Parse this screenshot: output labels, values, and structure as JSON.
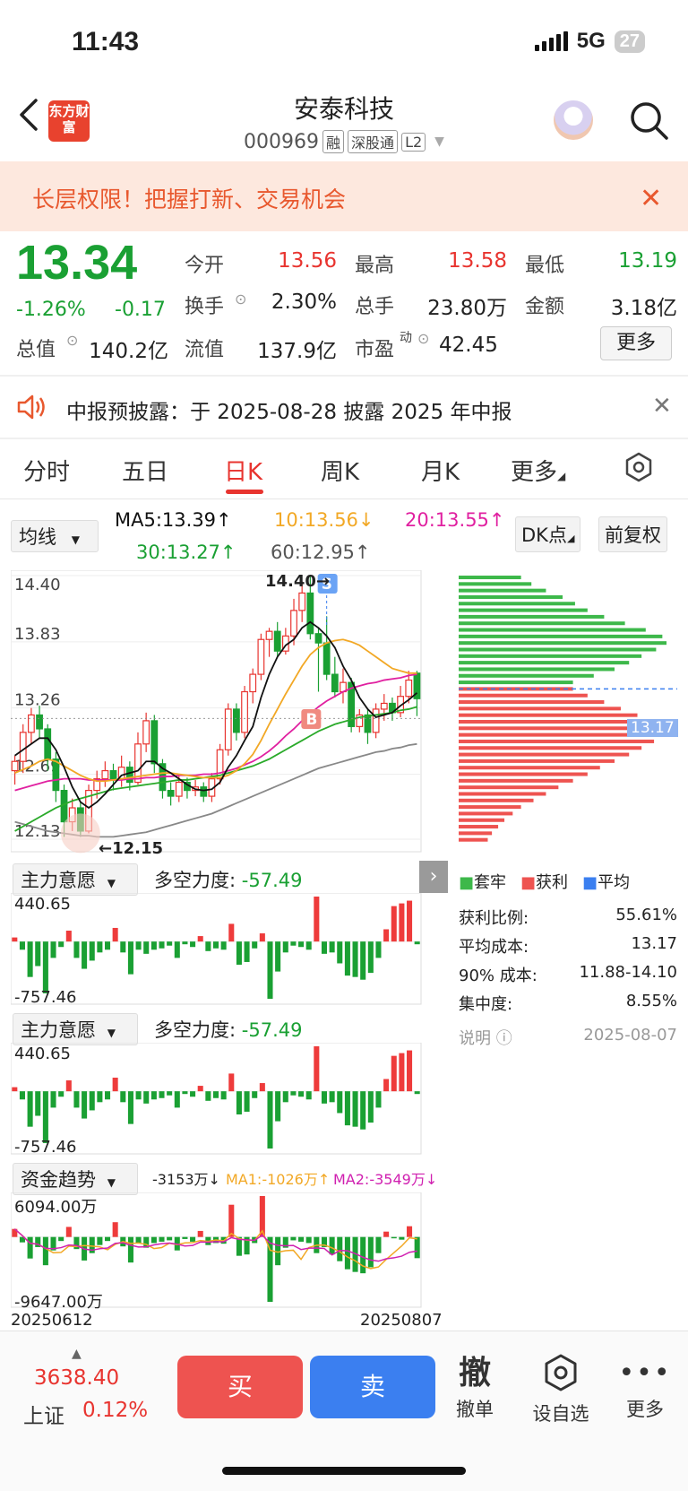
{
  "status": {
    "time": "11:43",
    "network": "5G",
    "battery": "27"
  },
  "header": {
    "title": "安泰科技",
    "code": "000969",
    "tags": [
      "融",
      "深股通",
      "L2"
    ],
    "logo_text": "东方财富"
  },
  "banner": {
    "text": "长层权限！把握打新、交易机会"
  },
  "quote": {
    "price": "13.34",
    "change_pct": "-1.26%",
    "change_abs": "-0.17",
    "open_label": "今开",
    "open": "13.56",
    "high_label": "最高",
    "high": "13.58",
    "low_label": "最低",
    "low": "13.19",
    "turnover_label": "换手",
    "turnover": "2.30%",
    "volume_label": "总手",
    "volume": "23.80万",
    "amount_label": "金额",
    "amount": "3.18亿",
    "mktcap_label": "总值",
    "mktcap": "140.2亿",
    "float_label": "流值",
    "float": "137.9亿",
    "pe_label": "市盈",
    "pe_sup": "动",
    "pe": "42.45",
    "more_label": "更多"
  },
  "notice": {
    "text": "中报预披露：于 2025-08-28 披露 2025 年中报"
  },
  "tabs": [
    "分时",
    "五日",
    "日K",
    "周K",
    "月K",
    "更多"
  ],
  "active_tab": "日K",
  "ma": {
    "selector": "均线",
    "ma5": "MA5:13.39↑",
    "ma10": "10:13.56↓",
    "ma20": "20:13.55↑",
    "ma30": "30:13.27↑",
    "ma60": "60:12.95↑",
    "dk_btn": "DK点",
    "fq_btn": "前复权"
  },
  "colors": {
    "up": "#e8342f",
    "down": "#1aa033",
    "ma5": "#111111",
    "ma10": "#f2a825",
    "ma20": "#e020a0",
    "ma30": "#2aaa2a",
    "ma60": "#888888",
    "avg": "#3b7ff0"
  },
  "kline": {
    "y_labels": [
      "14.40",
      "13.83",
      "13.26",
      "12.69",
      "12.13"
    ],
    "ylim": [
      12.13,
      14.4
    ],
    "high_mark": "14.40→",
    "low_mark": "←12.15",
    "b_marker": "B",
    "s_marker": "S",
    "avg_cost_tag": "13.17",
    "candles": [
      [
        12.72,
        12.8,
        12.6,
        12.85
      ],
      [
        12.8,
        13.05,
        12.7,
        13.12
      ],
      [
        13.05,
        13.2,
        12.95,
        13.26
      ],
      [
        13.2,
        13.08,
        13.0,
        13.28
      ],
      [
        13.08,
        12.82,
        12.72,
        13.12
      ],
      [
        12.82,
        12.55,
        12.45,
        12.88
      ],
      [
        12.55,
        12.28,
        12.15,
        12.6
      ],
      [
        12.28,
        12.4,
        12.2,
        12.48
      ],
      [
        12.4,
        12.2,
        12.15,
        12.45
      ],
      [
        12.2,
        12.55,
        12.18,
        12.6
      ],
      [
        12.55,
        12.65,
        12.48,
        12.72
      ],
      [
        12.65,
        12.72,
        12.58,
        12.8
      ],
      [
        12.72,
        12.65,
        12.55,
        12.78
      ],
      [
        12.65,
        12.75,
        12.58,
        12.85
      ],
      [
        12.75,
        12.62,
        12.55,
        12.8
      ],
      [
        12.62,
        12.95,
        12.6,
        13.05
      ],
      [
        12.95,
        13.15,
        12.88,
        13.22
      ],
      [
        13.15,
        12.78,
        12.7,
        13.2
      ],
      [
        12.78,
        12.55,
        12.48,
        12.82
      ],
      [
        12.55,
        12.5,
        12.42,
        12.62
      ],
      [
        12.5,
        12.62,
        12.45,
        12.68
      ],
      [
        12.62,
        12.55,
        12.48,
        12.66
      ],
      [
        12.55,
        12.58,
        12.5,
        12.64
      ],
      [
        12.58,
        12.5,
        12.45,
        12.62
      ],
      [
        12.5,
        12.65,
        12.45,
        12.7
      ],
      [
        12.65,
        12.9,
        12.6,
        12.95
      ],
      [
        12.9,
        13.25,
        12.85,
        13.3
      ],
      [
        13.25,
        13.05,
        12.98,
        13.3
      ],
      [
        13.05,
        13.4,
        13.0,
        13.45
      ],
      [
        13.4,
        13.55,
        13.3,
        13.6
      ],
      [
        13.55,
        13.85,
        13.5,
        13.9
      ],
      [
        13.85,
        13.92,
        13.7,
        13.95
      ],
      [
        13.92,
        13.75,
        13.7,
        14.0
      ],
      [
        13.75,
        13.88,
        13.72,
        13.95
      ],
      [
        13.88,
        14.1,
        13.8,
        14.2
      ],
      [
        14.1,
        14.25,
        14.0,
        14.35
      ],
      [
        14.25,
        13.9,
        13.85,
        14.4
      ],
      [
        13.9,
        13.82,
        13.4,
        13.95
      ],
      [
        13.82,
        13.55,
        13.5,
        14.05
      ],
      [
        13.55,
        13.4,
        13.35,
        13.7
      ],
      [
        13.4,
        13.48,
        13.3,
        13.6
      ],
      [
        13.48,
        13.1,
        13.05,
        13.52
      ],
      [
        13.1,
        13.2,
        13.05,
        13.25
      ],
      [
        13.2,
        13.05,
        12.95,
        13.25
      ],
      [
        13.05,
        13.25,
        13.0,
        13.3
      ],
      [
        13.25,
        13.3,
        13.15,
        13.38
      ],
      [
        13.3,
        13.22,
        13.15,
        13.35
      ],
      [
        13.22,
        13.36,
        13.18,
        13.45
      ],
      [
        13.36,
        13.5,
        13.3,
        13.58
      ],
      [
        13.56,
        13.34,
        13.19,
        13.58
      ]
    ],
    "ma5_line": [
      12.85,
      12.9,
      12.95,
      13.0,
      13.0,
      12.9,
      12.75,
      12.58,
      12.45,
      12.4,
      12.45,
      12.52,
      12.6,
      12.68,
      12.7,
      12.72,
      12.8,
      12.8,
      12.74,
      12.7,
      12.65,
      12.6,
      12.56,
      12.55,
      12.56,
      12.62,
      12.75,
      12.85,
      12.98,
      13.1,
      13.35,
      13.55,
      13.7,
      13.8,
      13.85,
      13.95,
      14.0,
      13.95,
      13.88,
      13.78,
      13.62,
      13.5,
      13.35,
      13.25,
      13.18,
      13.2,
      13.22,
      13.28,
      13.33,
      13.39
    ],
    "ma10_line": [
      12.7,
      12.73,
      12.76,
      12.8,
      12.82,
      12.8,
      12.76,
      12.72,
      12.68,
      12.65,
      12.63,
      12.63,
      12.64,
      12.65,
      12.66,
      12.67,
      12.68,
      12.69,
      12.7,
      12.7,
      12.69,
      12.68,
      12.67,
      12.66,
      12.66,
      12.66,
      12.68,
      12.72,
      12.78,
      12.86,
      12.98,
      13.12,
      13.25,
      13.38,
      13.5,
      13.62,
      13.72,
      13.78,
      13.82,
      13.84,
      13.85,
      13.83,
      13.8,
      13.75,
      13.7,
      13.65,
      13.6,
      13.58,
      13.56,
      13.56
    ],
    "ma20_line": [
      12.55,
      12.57,
      12.59,
      12.61,
      12.63,
      12.64,
      12.65,
      12.65,
      12.65,
      12.64,
      12.64,
      12.64,
      12.64,
      12.64,
      12.65,
      12.65,
      12.66,
      12.66,
      12.67,
      12.67,
      12.68,
      12.68,
      12.68,
      12.69,
      12.69,
      12.7,
      12.72,
      12.74,
      12.77,
      12.8,
      12.84,
      12.89,
      12.95,
      13.02,
      13.08,
      13.15,
      13.21,
      13.27,
      13.32,
      13.36,
      13.4,
      13.43,
      13.45,
      13.47,
      13.48,
      13.5,
      13.51,
      13.52,
      13.54,
      13.55
    ],
    "ma30_line": [
      12.2,
      12.24,
      12.28,
      12.32,
      12.36,
      12.4,
      12.43,
      12.46,
      12.48,
      12.5,
      12.52,
      12.54,
      12.56,
      12.57,
      12.58,
      12.59,
      12.6,
      12.61,
      12.62,
      12.63,
      12.64,
      12.64,
      12.65,
      12.66,
      12.67,
      12.68,
      12.7,
      12.72,
      12.74,
      12.76,
      12.79,
      12.82,
      12.86,
      12.9,
      12.94,
      12.98,
      13.02,
      13.06,
      13.09,
      13.12,
      13.14,
      13.16,
      13.18,
      13.19,
      13.2,
      13.21,
      13.22,
      13.24,
      13.25,
      13.27
    ],
    "ma60_line": [
      12.28,
      12.26,
      12.24,
      12.22,
      12.2,
      12.19,
      12.18,
      12.17,
      12.16,
      12.16,
      12.15,
      12.15,
      12.15,
      12.16,
      12.17,
      12.18,
      12.19,
      12.21,
      12.23,
      12.25,
      12.27,
      12.29,
      12.31,
      12.33,
      12.35,
      12.38,
      12.41,
      12.44,
      12.47,
      12.5,
      12.53,
      12.56,
      12.59,
      12.62,
      12.65,
      12.68,
      12.71,
      12.74,
      12.76,
      12.78,
      12.8,
      12.82,
      12.84,
      12.86,
      12.88,
      12.89,
      12.91,
      12.92,
      12.94,
      12.95
    ]
  },
  "distribution": {
    "legend_trapped": "套牢",
    "legend_profit": "获利",
    "legend_avg": "平均",
    "profit_ratio_label": "获利比例:",
    "profit_ratio": "55.61%",
    "avg_cost_label": "平均成本:",
    "avg_cost": "13.17",
    "cost90_label": "90% 成本:",
    "cost90": "11.88-14.10",
    "concentration_label": "集中度:",
    "concentration": "8.55%",
    "note_label": "说明",
    "date": "2025-08-07",
    "bars_green": [
      0.3,
      0.35,
      0.42,
      0.5,
      0.56,
      0.62,
      0.7,
      0.8,
      0.9,
      0.98,
      1.0,
      0.95,
      0.88,
      0.82,
      0.75,
      0.65,
      0.55
    ],
    "bars_red": [
      0.55,
      0.62,
      0.7,
      0.78,
      0.86,
      0.92,
      0.96,
      0.98,
      0.94,
      0.88,
      0.82,
      0.75,
      0.68,
      0.62,
      0.55,
      0.48,
      0.42,
      0.36,
      0.3,
      0.26,
      0.22,
      0.19,
      0.16,
      0.14
    ]
  },
  "indicator1": {
    "selector": "主力意愿",
    "label": "多空力度:",
    "value": "-57.49",
    "ymax": "440.65",
    "ymin": "-757.46",
    "bars": [
      30,
      -60,
      -260,
      -180,
      -380,
      -120,
      -40,
      80,
      -120,
      -200,
      -140,
      -80,
      -60,
      100,
      -80,
      -240,
      -60,
      -90,
      -60,
      -50,
      -30,
      -120,
      -20,
      -40,
      40,
      -70,
      -50,
      -60,
      130,
      -170,
      -150,
      -50,
      60,
      -420,
      -220,
      -80,
      -30,
      -40,
      -60,
      330,
      -90,
      -80,
      -160,
      -250,
      -260,
      -280,
      -230,
      -120,
      90,
      260,
      280,
      300,
      -20
    ]
  },
  "indicator2": {
    "selector": "主力意愿",
    "label": "多空力度:",
    "value": "-57.49",
    "ymax": "440.65",
    "ymin": "-757.46",
    "bars": [
      30,
      -60,
      -260,
      -180,
      -380,
      -120,
      -40,
      80,
      -120,
      -200,
      -140,
      -80,
      -60,
      100,
      -80,
      -240,
      -60,
      -90,
      -60,
      -50,
      -30,
      -120,
      -20,
      -40,
      40,
      -70,
      -50,
      -60,
      130,
      -170,
      -150,
      -50,
      60,
      -420,
      -220,
      -80,
      -30,
      -40,
      -60,
      330,
      -90,
      -80,
      -160,
      -250,
      -260,
      -280,
      -230,
      -120,
      90,
      260,
      280,
      300,
      -20
    ]
  },
  "fund_flow": {
    "selector": "资金趋势",
    "value": "-3153万↓",
    "ma1": "MA1:-1026万↑",
    "ma2": "MA2:-3549万↓",
    "ymax": "6094.00万",
    "ymin": "-9647.00万",
    "x_start": "20250612",
    "x_end": "20250807",
    "bars": [
      1200,
      -800,
      -3200,
      -1500,
      -4200,
      -2000,
      -600,
      1500,
      -1800,
      -3500,
      -2400,
      -1200,
      -600,
      2200,
      -1400,
      -3800,
      -900,
      -1600,
      -900,
      -700,
      -500,
      -2000,
      -300,
      -700,
      900,
      -1200,
      -900,
      -1000,
      4800,
      -2800,
      -2600,
      -900,
      6094,
      -9647,
      -4200,
      -1600,
      -500,
      -700,
      -900,
      -2400,
      -1500,
      -2600,
      -3600,
      -4800,
      -5200,
      -5400,
      -4500,
      -2400,
      800,
      -200,
      -400,
      1600,
      -3153
    ]
  },
  "bottom": {
    "index_value": "3638.40",
    "index_name": "上证",
    "index_change": "0.12%",
    "buy": "买",
    "sell": "卖",
    "cancel": "撤单",
    "cancel_icon": "撤",
    "watch": "设自选",
    "more": "更多"
  }
}
